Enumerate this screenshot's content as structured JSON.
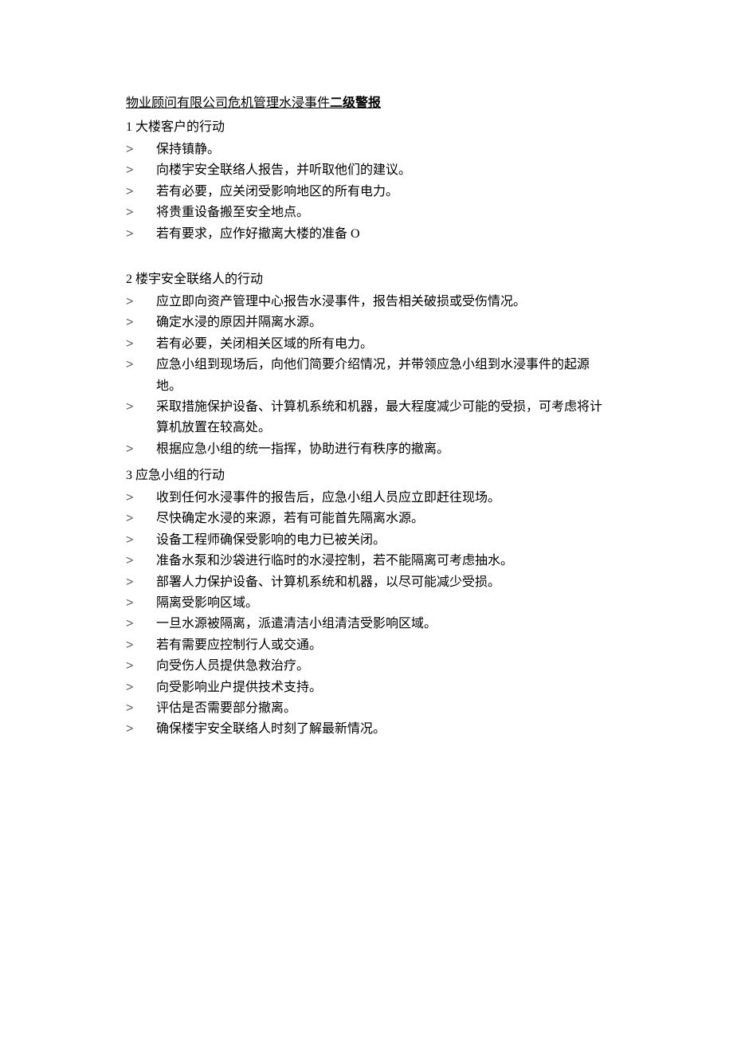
{
  "title": {
    "prefix": "物业顾问有限公司危机管理水浸事件",
    "bold": "二级警报"
  },
  "sections": [
    {
      "heading": "1 大楼客户的行动",
      "items": [
        "保持镇静。",
        "向楼宇安全联络人报告，并听取他们的建议。",
        "若有必要，应关闭受影响地区的所有电力。",
        "将贵重设备搬至安全地点。",
        "若有要求，应作好撤离大楼的准备 O"
      ],
      "spacer_after": true
    },
    {
      "heading": "2 楼宇安全联络人的行动",
      "items": [
        "应立即向资产管理中心报告水浸事件，报告相关破损或受伤情况。",
        "确定水浸的原因并隔离水源。",
        "若有必要，关闭相关区域的所有电力。",
        "应急小组到现场后，向他们简要介绍情况，并带领应急小组到水浸事件的起源地。",
        "采取措施保护设备、计算机系统和机器，最大程度减少可能的受损，可考虑将计算机放置在较高处。",
        "根据应急小组的统一指挥，协助进行有秩序的撤离。"
      ],
      "spacer_after": false
    },
    {
      "heading": "3 应急小组的行动",
      "items": [
        "收到任何水浸事件的报告后，应急小组人员应立即赶往现场。",
        "尽快确定水浸的来源，若有可能首先隔离水源。",
        "设备工程师确保受影响的电力已被关闭。",
        "准备水泵和沙袋进行临时的水浸控制，若不能隔离可考虑抽水。",
        "部署人力保护设备、计算机系统和机器，以尽可能减少受损。",
        "隔离受影响区域。",
        "一旦水源被隔离，派遣清洁小组清洁受影响区域。",
        "若有需要应控制行人或交通。",
        "向受伤人员提供急救治疗。",
        "向受影响业户提供技术支持。",
        "评估是否需要部分撤离。",
        "确保楼宇安全联络人时刻了解最新情况。"
      ],
      "spacer_after": false
    }
  ],
  "bullet_glyph": ">"
}
